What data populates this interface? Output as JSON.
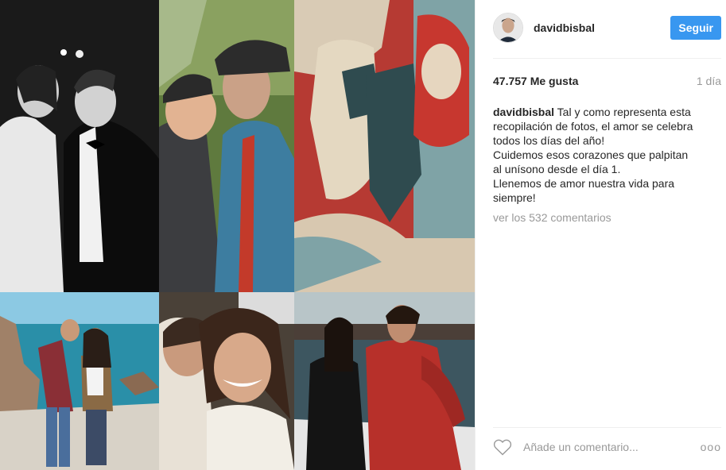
{
  "post": {
    "username": "davidbisbal",
    "follow_label": "Seguir",
    "likes": "47.757 Me gusta",
    "age": "1 día",
    "caption": {
      "user": "davidbisbal",
      "lines": [
        "Tal y como representa esta",
        "recopilación de fotos, el amor se celebra",
        "todos los días del año!",
        "Cuidemos esos corazones que palpitan",
        "al unísono desde el día 1.",
        "Llenemos de amor nuestra vida para",
        "siempre!"
      ]
    },
    "comments_link": "ver los 532 comentarios",
    "comment_placeholder": "Añade un comentario...",
    "more_label": "ooo"
  },
  "icons": {
    "heart": "heart-icon",
    "more": "more-options-icon"
  },
  "colors": {
    "follow_button": "#3897f0",
    "muted_text": "#999999"
  }
}
